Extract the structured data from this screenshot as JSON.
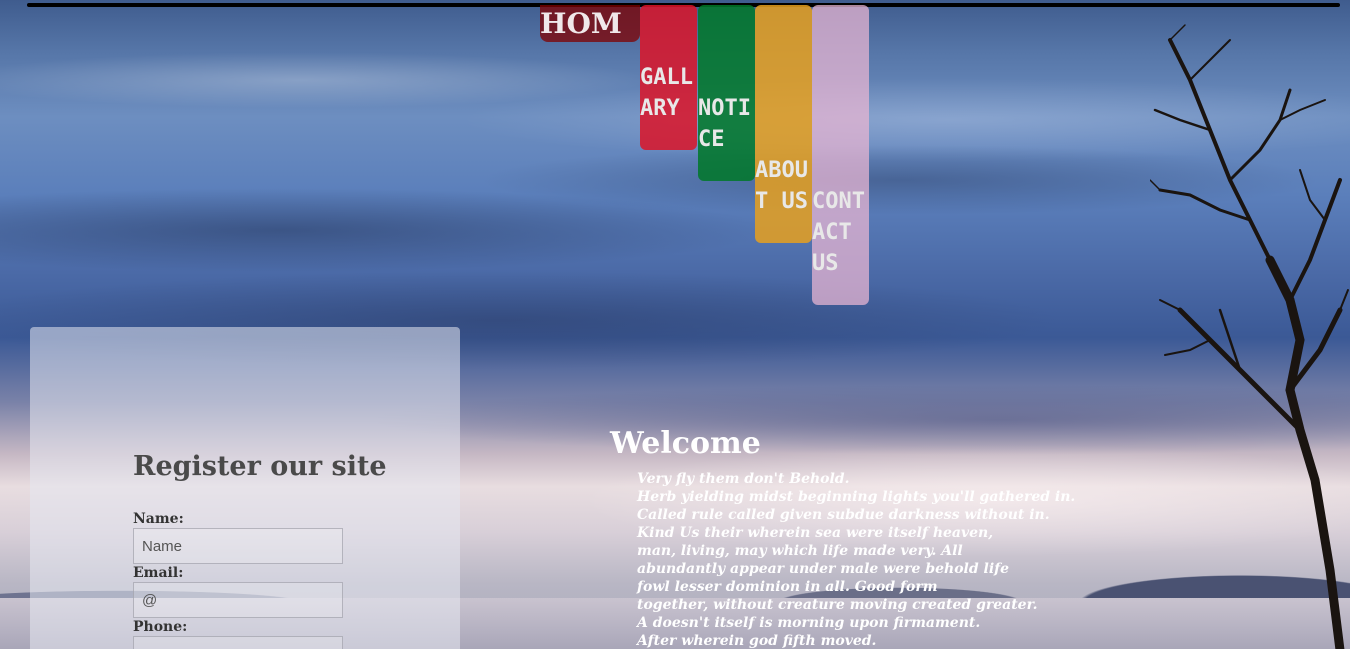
{
  "nav": {
    "home": "HOME",
    "gallery": "GALLARY",
    "notice": "NOTICE",
    "about": "ABOUT US",
    "contact": "CONTACT US"
  },
  "register": {
    "title": "Register our site",
    "name_label": "Name:",
    "name_placeholder": "Name",
    "email_label": "Email:",
    "email_placeholder": "@",
    "phone_label": "Phone:"
  },
  "welcome": {
    "title": "Welcome",
    "lines": [
      "Very fly them don't Behold.",
      "Herb yielding midst beginning lights you'll gathered in.",
      "Called rule called given subdue darkness without in.",
      "Kind Us their wherein sea were itself heaven,",
      "man, living, may which life made very. All",
      "abundantly appear under male were behold life",
      "fowl lesser dominion in all. Good form",
      "together, without creature moving created greater.",
      "A doesn't itself is morning upon firmament.",
      "After wherein god fifth moved."
    ]
  },
  "colors": {
    "home": "#800000",
    "gallery": "#dc1428",
    "notice": "#007828",
    "about": "#e6a01e",
    "contact": "#e6b4d2"
  }
}
